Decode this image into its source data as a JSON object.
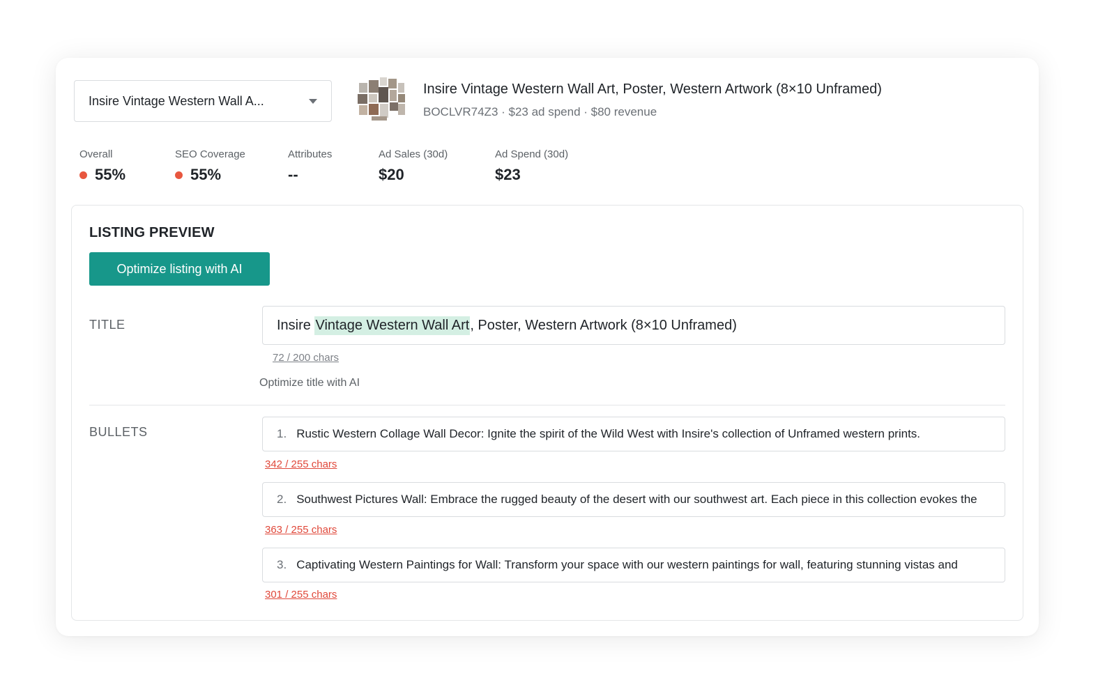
{
  "selector": {
    "value": "Insire Vintage Western Wall A..."
  },
  "product": {
    "title": "Insire Vintage Western Wall Art, Poster, Western Artwork (8×10 Unframed)",
    "meta": "BOCLVR74Z3 · $23 ad spend · $80 revenue"
  },
  "stats": [
    {
      "label": "Overall",
      "value": "55%",
      "status_color": "#e8573f"
    },
    {
      "label": "SEO Coverage",
      "value": "55%",
      "status_color": "#e8573f"
    },
    {
      "label": "Attributes",
      "value": "--"
    },
    {
      "label": "Ad Sales (30d)",
      "value": "$20"
    },
    {
      "label": "Ad Spend (30d)",
      "value": "$23"
    }
  ],
  "preview": {
    "heading": "LISTING PREVIEW",
    "optimize_button": "Optimize listing with AI",
    "title_section": {
      "label": "TITLE",
      "prefix": "Insire ",
      "highlight": "Vintage Western Wall Art",
      "suffix": ", Poster, Western Artwork (8×10 Unframed)",
      "count": "72 / 200 chars",
      "optimize_link": "Optimize title with AI"
    },
    "bullets_section": {
      "label": "BULLETS",
      "items": [
        {
          "num": "1.",
          "text": "Rustic Western Collage Wall Decor: Ignite the spirit of the Wild West with Insire's collection of Unframed western prints.",
          "count": "342 / 255 chars"
        },
        {
          "num": "2.",
          "text": "Southwest Pictures Wall: Embrace the rugged beauty of the desert with our southwest art. Each piece in this collection evokes the",
          "count": "363 / 255 chars"
        },
        {
          "num": "3.",
          "text": "Captivating Western Paintings for Wall: Transform your space with our western paintings for wall, featuring stunning vistas and",
          "count": "301 / 255 chars"
        }
      ]
    }
  },
  "colors": {
    "accent": "#17978a",
    "highlight": "#d4efe3",
    "error": "#e0483a"
  }
}
